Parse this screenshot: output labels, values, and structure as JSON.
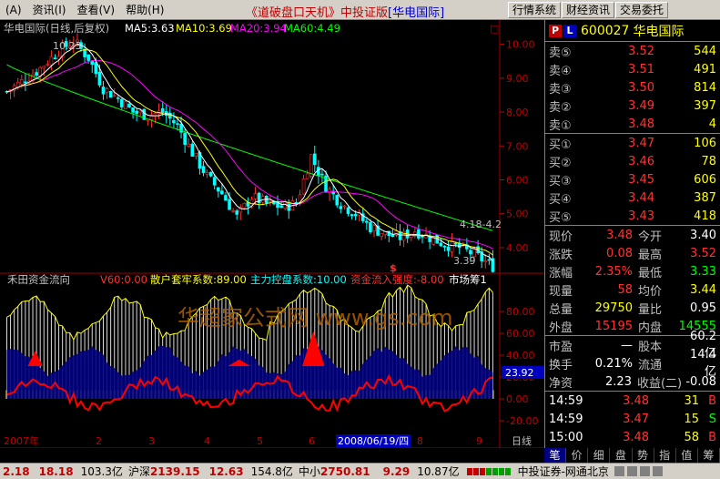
{
  "menu": [
    "(A)",
    "资讯(I)",
    "查看(V)",
    "帮助(H)"
  ],
  "app_title_main": "《道破盘口天机》中投证版",
  "app_title_stock": "[华电国际]",
  "toolbar": [
    "行情系统",
    "财经资讯",
    "交易委托"
  ],
  "kline_header": {
    "name": "华电国际(日线,后复权)",
    "ma5": "MA5:3.63",
    "ma10": "MA10:3.69",
    "ma20": "MA20:3.94",
    "ma60": "MA60:4.49",
    "marker": "□"
  },
  "price_axis": [
    "10.00",
    "9.00",
    "8.00",
    "7.00",
    "6.00",
    "5.00",
    "4.00"
  ],
  "annotations": {
    "high": "10.23",
    "low": "3.39",
    "range": "4.18-4.2"
  },
  "indicator_header": {
    "name": "禾田资金流向",
    "v60": "V60:0.00",
    "retail": "散户套牢系数:89.00",
    "main": "主力控盘系数:10.00",
    "flow": "资金流入强度:-8.00",
    "market": "市场筹1"
  },
  "indicator_axis": [
    "80.00",
    "60.00",
    "40.00",
    "20.00",
    "0.00",
    "-20.00"
  ],
  "indicator_value": "23.92",
  "date_axis": {
    "year": "2007年",
    "months": [
      "2",
      "3",
      "4",
      "5",
      "6",
      "7",
      "8",
      "9"
    ],
    "cursor_date": "2008/06/19/四",
    "period": "日线"
  },
  "stock": {
    "code": "600027",
    "name": "华电国际"
  },
  "sell_orders": [
    {
      "label": "卖⑤",
      "price": "3.52",
      "vol": "544"
    },
    {
      "label": "卖④",
      "price": "3.51",
      "vol": "491"
    },
    {
      "label": "卖③",
      "price": "3.50",
      "vol": "814"
    },
    {
      "label": "卖②",
      "price": "3.49",
      "vol": "397"
    },
    {
      "label": "卖①",
      "price": "3.48",
      "vol": "4"
    }
  ],
  "buy_orders": [
    {
      "label": "买①",
      "price": "3.47",
      "vol": "106"
    },
    {
      "label": "买②",
      "price": "3.46",
      "vol": "78"
    },
    {
      "label": "买③",
      "price": "3.45",
      "vol": "606"
    },
    {
      "label": "买④",
      "price": "3.44",
      "vol": "387"
    },
    {
      "label": "买⑤",
      "price": "3.43",
      "vol": "418"
    }
  ],
  "stats": [
    {
      "l1": "现价",
      "v1": "3.48",
      "l2": "今开",
      "v2": "3.40"
    },
    {
      "l1": "涨跌",
      "v1": "0.08",
      "l2": "最高",
      "v2": "3.52"
    },
    {
      "l1": "涨幅",
      "v1": "2.35%",
      "l2": "最低",
      "v2": "3.33"
    },
    {
      "l1": "现量",
      "v1": "58",
      "l2": "均价",
      "v2": "3.44"
    },
    {
      "l1": "总量",
      "v1": "29750",
      "l2": "量比",
      "v2": "0.95"
    },
    {
      "l1": "外盘",
      "v1": "15195",
      "l2": "内盘",
      "v2": "14555"
    }
  ],
  "fin": [
    {
      "l1": "市盈",
      "v1": "—",
      "l2": "股本",
      "v2": "60.2亿"
    },
    {
      "l1": "换手",
      "v1": "0.21%",
      "l2": "流通",
      "v2": "14.4亿"
    },
    {
      "l1": "净资",
      "v1": "2.23",
      "l2": "收益(二)",
      "v2": "-0.08"
    }
  ],
  "ticks": [
    {
      "time": "14:59",
      "price": "3.48",
      "vol": "31",
      "side": "B"
    },
    {
      "time": "14:59",
      "price": "3.47",
      "vol": "15",
      "side": "S"
    },
    {
      "time": "15:00",
      "price": "3.48",
      "vol": "58",
      "side": "B"
    }
  ],
  "tabs": [
    "笔",
    "价",
    "细",
    "盘",
    "势",
    "指",
    "值",
    "筹"
  ],
  "status": {
    "first": "2.18",
    "a1": "18.18",
    "a2": "103.3亿",
    "sh_label": "沪深",
    "sh_val": "2139.15",
    "sh_chg": "12.63",
    "sh_amt": "154.8亿",
    "zx_label": "中小",
    "zx_val": "2750.81",
    "zx_chg": "9.29",
    "zx_amt": "10.87亿",
    "broker": "中投证券-网通北京"
  },
  "watermark": "华超家公式网 www.gs.com",
  "colors": {
    "up": "#ff3232",
    "down": "#00ffff",
    "ma5": "#ffffff",
    "ma10": "#ffff00",
    "ma20": "#ff00ff",
    "ma60": "#00ff00",
    "label_yellow": "#ffff00",
    "label_cyan": "#00ffff"
  }
}
